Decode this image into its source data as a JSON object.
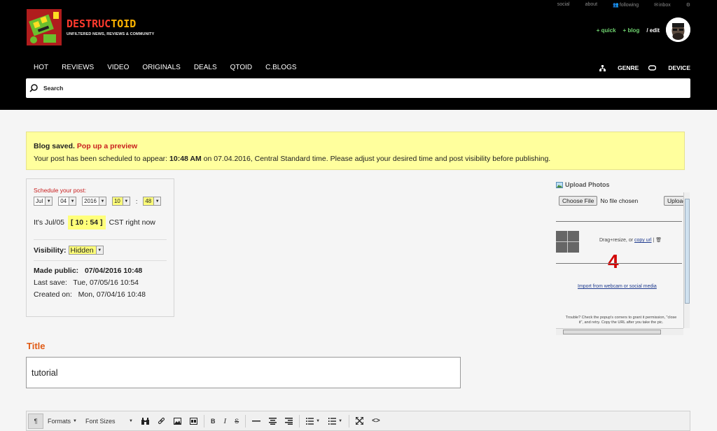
{
  "header": {
    "top_links": [
      "social",
      "about",
      "following",
      "inbox"
    ],
    "logo_main": "DESTRUC",
    "logo_accent": "TOID",
    "tagline": "UNFILTERED NEWS, REVIEWS & COMMUNITY",
    "quick": "+ quick",
    "blog": "+ blog",
    "edit": "/ edit",
    "nav": [
      "HOT",
      "REVIEWS",
      "VIDEO",
      "ORIGINALS",
      "DEALS",
      "QTOID",
      "C.BLOGS"
    ],
    "genre": "GENRE",
    "device": "DEVICE",
    "search_placeholder": "Search"
  },
  "notice": {
    "saved": "Blog saved.",
    "preview_link": "Pop up a preview",
    "line2_prefix": "Your post has been scheduled to appear:",
    "line2_time": "10:48 AM",
    "line2_suffix": "on 07.04.2016, Central Standard time. Please adjust your desired time and post visibility before publishing."
  },
  "schedule": {
    "label": "Schedule your post:",
    "month": "Jul",
    "day": "04",
    "year": "2016",
    "hour": "10",
    "minute": "48",
    "colon": ":",
    "now_prefix": "It's Jul/05",
    "now_clock": "[ 10 : 54 ]",
    "now_suffix": "CST right now",
    "visibility_label": "Visibility:",
    "visibility_value": "Hidden",
    "made_public_label": "Made public:",
    "made_public_value": "07/04/2016 10:48",
    "last_save": "Last save:   Tue, 07/05/16 10:54",
    "created_on": "Created on:   Mon, 07/04/16 10:48"
  },
  "upload": {
    "title": "Upload Photos",
    "choose_file": "Choose File",
    "no_file": "No file chosen",
    "upload_btn": "Upload",
    "drag_text": "Drag+resize, or",
    "copy_url": "copy url",
    "annotation": "4",
    "webcam": "Import from webcam or social media",
    "trouble": "Trouble? Check the popup's corners to grant it permission, \"close it\", and retry. Copy the URL after you take the pic."
  },
  "post": {
    "title_label": "Title",
    "title_value": "tutorial"
  },
  "toolbar": {
    "paragraph": "¶",
    "formats": "Formats",
    "font_sizes": "Font Sizes"
  }
}
